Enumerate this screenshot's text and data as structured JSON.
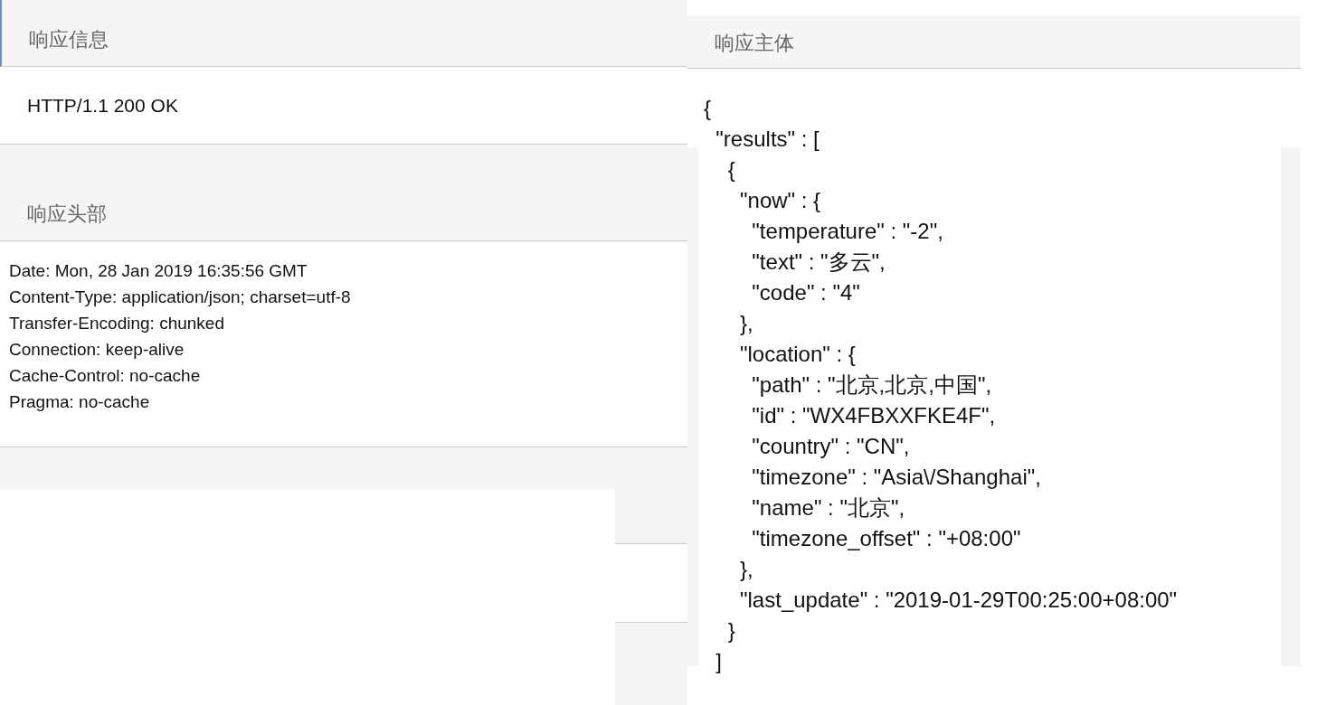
{
  "response_info": {
    "title": "响应信息",
    "status_line": "HTTP/1.1 200 OK"
  },
  "response_headers": {
    "title": "响应头部",
    "lines": [
      "Date: Mon, 28 Jan 2019 16:35:56 GMT",
      "Content-Type: application/json; charset=utf-8",
      "Transfer-Encoding: chunked",
      "Connection: keep-alive",
      "Cache-Control: no-cache",
      "Pragma: no-cache"
    ]
  },
  "response_body": {
    "title": "响应主体",
    "lines": [
      "{",
      "  \"results\" : [",
      "    {",
      "      \"now\" : {",
      "        \"temperature\" : \"-2\",",
      "        \"text\" : \"多云\",",
      "        \"code\" : \"4\"",
      "      },",
      "      \"location\" : {",
      "        \"path\" : \"北京,北京,中国\",",
      "        \"id\" : \"WX4FBXXFKE4F\",",
      "        \"country\" : \"CN\",",
      "        \"timezone\" : \"Asia\\/Shanghai\",",
      "        \"name\" : \"北京\",",
      "        \"timezone_offset\" : \"+08:00\"",
      "      },",
      "      \"last_update\" : \"2019-01-29T00:25:00+08:00\"",
      "    }",
      "  ]"
    ]
  }
}
